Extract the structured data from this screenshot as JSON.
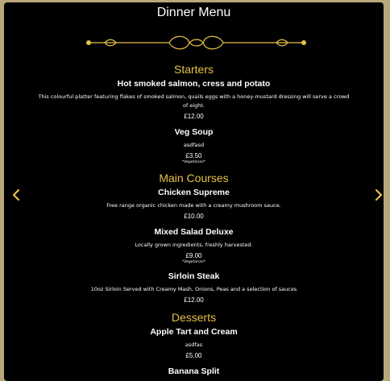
{
  "menu": {
    "title": "Dinner Menu",
    "sections": [
      {
        "heading": "Starters",
        "items": [
          {
            "name": "Hot smoked salmon, cress and potato",
            "description": "This colourful platter featuring flakes of smoked salmon, quails eggs with a honey-mustard dressing will serve a crowd of eight.",
            "price": "£12.00",
            "note": ""
          },
          {
            "name": "Veg Soup",
            "description": "asdfasd",
            "price": "£3.50",
            "note": "*Vegetarian*"
          }
        ]
      },
      {
        "heading": "Main Courses",
        "items": [
          {
            "name": "Chicken Supreme",
            "description": "Free range organic chicken made with a creamy mushroom sauce.",
            "price": "£10.00",
            "note": ""
          },
          {
            "name": "Mixed Salad Deluxe",
            "description": "Locally grown ingredients, freshly harvested.",
            "price": "£9.00",
            "note": "*Vegetarian*"
          },
          {
            "name": "Sirloin Steak",
            "description": "10oz Sirloin Served with Creamy Mash, Onions, Peas and a selection of sauces",
            "price": "£12.00",
            "note": ""
          }
        ]
      },
      {
        "heading": "Desserts",
        "items": [
          {
            "name": "Apple Tart and Cream",
            "description": "asdfas",
            "price": "£5.00",
            "note": ""
          },
          {
            "name": "Banana Split",
            "description": "",
            "price": "",
            "note": ""
          }
        ]
      }
    ]
  },
  "nav": {
    "prev_icon": "chevron-left-icon",
    "next_icon": "chevron-right-icon"
  },
  "colors": {
    "background": "#000000",
    "frame": "#b8a77a",
    "accent": "#e5c14a",
    "text": "#ffffff"
  }
}
